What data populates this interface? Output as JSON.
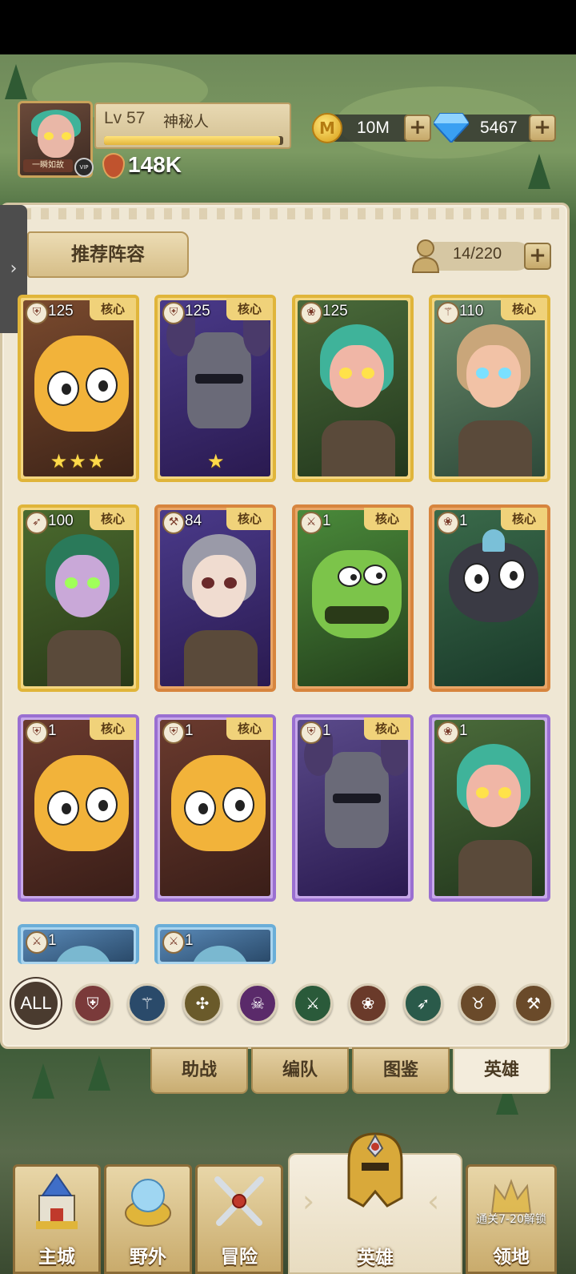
{
  "header": {
    "avatar_name": "一瞬如故",
    "avatar_badge": "VIP",
    "level_text": "Lv 57",
    "player_name": "神秘人",
    "xp_fraction": 0.98,
    "power": "148K",
    "gold_icon": "M",
    "gold": "10M",
    "gems": "5467"
  },
  "panel": {
    "recommend_label": "推荐阵容",
    "hero_count": "14/220"
  },
  "heroes": [
    {
      "level": "125",
      "core": "核心",
      "stars": "★★★",
      "rarity": "gold",
      "class": "shield"
    },
    {
      "level": "125",
      "core": "核心",
      "stars": "★",
      "rarity": "gold",
      "class": "shield"
    },
    {
      "level": "125",
      "core": "",
      "stars": "",
      "rarity": "gold",
      "class": "paw"
    },
    {
      "level": "110",
      "core": "核心",
      "stars": "",
      "rarity": "gold",
      "class": "staff"
    },
    {
      "level": "100",
      "core": "核心",
      "stars": "",
      "rarity": "gold",
      "class": "bow"
    },
    {
      "level": "84",
      "core": "核心",
      "stars": "",
      "rarity": "orange",
      "class": "axe"
    },
    {
      "level": "1",
      "core": "核心",
      "stars": "",
      "rarity": "orange",
      "class": "swords"
    },
    {
      "level": "1",
      "core": "核心",
      "stars": "",
      "rarity": "orange",
      "class": "paw"
    },
    {
      "level": "1",
      "core": "核心",
      "stars": "",
      "rarity": "purple",
      "class": "shield"
    },
    {
      "level": "1",
      "core": "核心",
      "stars": "",
      "rarity": "purple",
      "class": "shield"
    },
    {
      "level": "1",
      "core": "核心",
      "stars": "",
      "rarity": "purple",
      "class": "shield"
    },
    {
      "level": "1",
      "core": "",
      "stars": "",
      "rarity": "purple",
      "class": "paw"
    },
    {
      "level": "1",
      "core": "",
      "stars": "",
      "rarity": "blue",
      "class": "swords"
    },
    {
      "level": "1",
      "core": "",
      "stars": "",
      "rarity": "blue",
      "class": "swords"
    }
  ],
  "filters": {
    "all_label": "ALL",
    "icons": [
      "shield-icon",
      "staff-icon",
      "holy-icon",
      "skull-icon",
      "swords-icon",
      "paw-icon",
      "bow-icon",
      "horns-icon",
      "hammer-icon"
    ]
  },
  "tabs": [
    "助战",
    "编队",
    "图鉴",
    "英雄"
  ],
  "nav": {
    "main_city": "主城",
    "wild": "野外",
    "adventure": "冒险",
    "heroes": "英雄",
    "territory": "领地",
    "territory_lock": "通关7-20解锁"
  },
  "colors": {
    "gold": "#e0b53a",
    "orange": "#d7853e",
    "purple": "#9a6fd1",
    "blue": "#6aaed8",
    "panel": "#efe7d4"
  }
}
